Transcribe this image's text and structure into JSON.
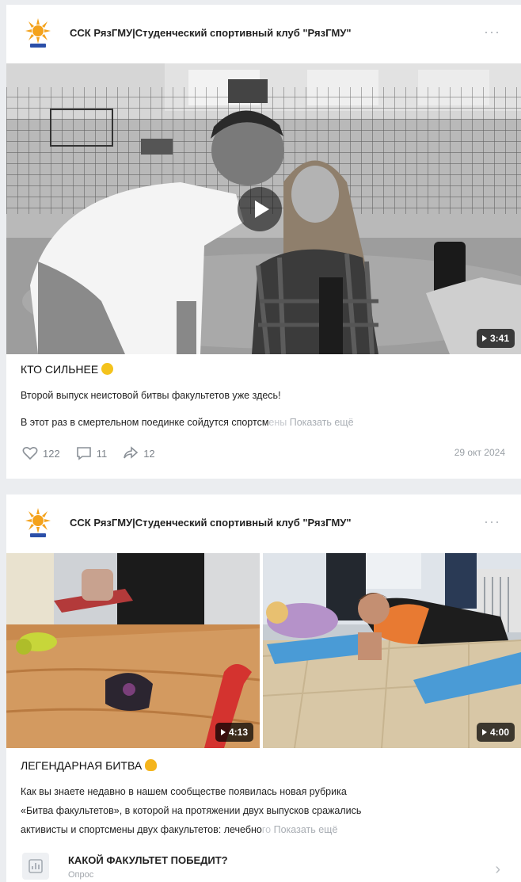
{
  "post1": {
    "author": "ССК РязГМУ|Студенческий спортивный клуб \"РязГМУ\"",
    "more": "···",
    "duration": "3:41",
    "title": "КТО СИЛЬНЕЕ",
    "line1": "Второй выпуск неистовой битвы факультетов уже здесь!",
    "line2_main": "В этот раз в смертельном поединке сойдутся спортсм",
    "line2_fade": "ены",
    "show_more": "Показать ещё",
    "likes": "122",
    "comments": "11",
    "shares": "12",
    "date": "29 окт 2024"
  },
  "post2": {
    "author": "ССК РязГМУ|Студенческий спортивный клуб \"РязГМУ\"",
    "more": "···",
    "duration_left": "4:13",
    "duration_right": "4:00",
    "title": "ЛЕГЕНДАРНАЯ БИТВА",
    "line1": "Как вы знаете недавно в нашем сообществе появилась новая рубрика",
    "line2": "«Битва факультетов», в которой на протяжении двух выпусков сражались",
    "line3_main": "активисты и спортсмены двух факультетов: лечебно",
    "line3_fade": "го",
    "show_more": "Показать ещё",
    "poll_title": "КАКОЙ ФАКУЛЬТЕТ ПОБЕДИТ?",
    "poll_sub": "Опрос"
  },
  "colors": {
    "accent_orange": "#f4a21c",
    "background": "#ebedf0",
    "muted": "#7d838a"
  },
  "icons": {
    "play": "play-icon",
    "like": "heart-icon",
    "comment": "comment-icon",
    "share": "share-icon",
    "poll": "poll-icon",
    "chevron": "chevron-right-icon"
  }
}
